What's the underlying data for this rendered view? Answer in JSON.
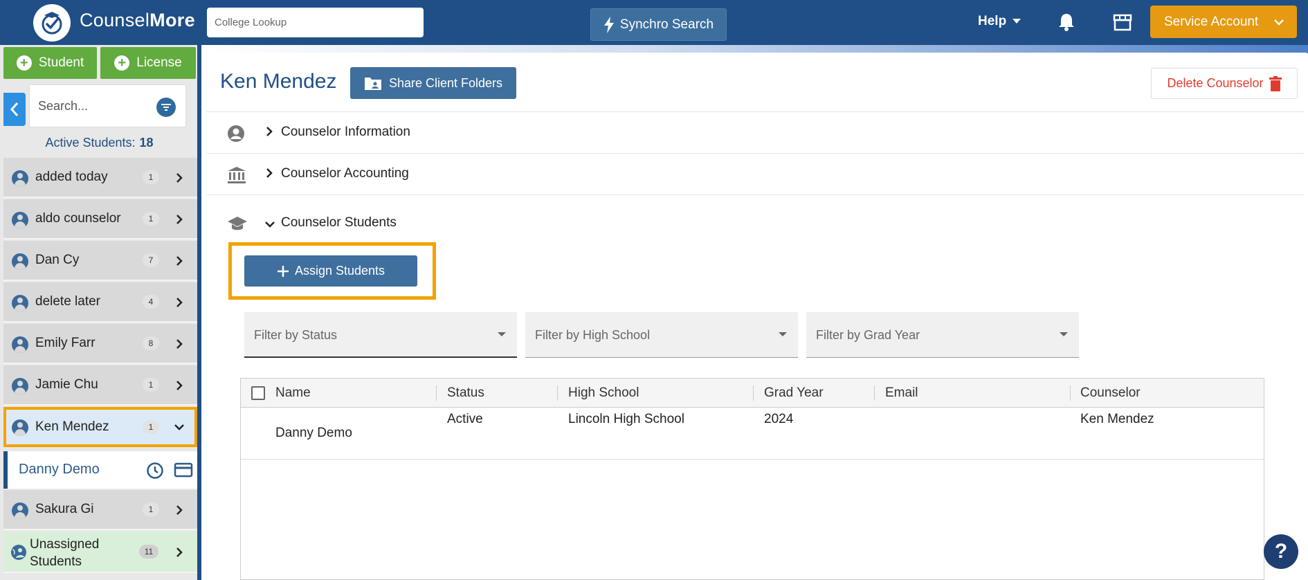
{
  "header": {
    "logo_light": "Counsel",
    "logo_bold": "More",
    "college_lookup_placeholder": "College Lookup",
    "synchro_label": "Synchro Search",
    "help_label": "Help",
    "service_label": "Service Account"
  },
  "sidebar": {
    "add_student_label": "Student",
    "add_license_label": "License",
    "search_placeholder": "Search...",
    "active_students_label": "Active Students:",
    "active_students_count": "18",
    "items": [
      {
        "label": "added today",
        "count": "1"
      },
      {
        "label": "aldo counselor",
        "count": "1"
      },
      {
        "label": "Dan Cy",
        "count": "7"
      },
      {
        "label": "delete later",
        "count": "4"
      },
      {
        "label": "Emily Farr",
        "count": "8"
      },
      {
        "label": "Jamie Chu",
        "count": "1"
      },
      {
        "label": "Ken Mendez",
        "count": "1"
      }
    ],
    "sub_item": "Danny Demo",
    "after_items": [
      {
        "label": "Sakura Gi",
        "count": "1"
      }
    ],
    "unassigned_line1": "Unassigned",
    "unassigned_line2": "Students",
    "unassigned_count": "11"
  },
  "main": {
    "title": "Ken Mendez",
    "share_label": "Share Client Folders",
    "delete_label": "Delete Counselor",
    "sections": [
      {
        "label": "Counselor Information"
      },
      {
        "label": "Counselor Accounting"
      },
      {
        "label": "Counselor Students"
      }
    ],
    "assign_label": "Assign Students",
    "filters": [
      "Filter by Status",
      "Filter by High School",
      "Filter by Grad Year"
    ],
    "columns": [
      "Name",
      "Status",
      "High School",
      "Grad Year",
      "Email",
      "Counselor"
    ],
    "rows": [
      {
        "name": "Danny Demo",
        "status": "Active",
        "high_school": "Lincoln High School",
        "grad_year": "2024",
        "email": "",
        "counselor": "Ken Mendez"
      }
    ]
  },
  "colors": {
    "header_bg": "#1f4f86",
    "accent_orange": "#e59a12",
    "highlight_outline": "#f2a300",
    "green": "#61ab3f",
    "delete_red": "#e03c2e"
  }
}
